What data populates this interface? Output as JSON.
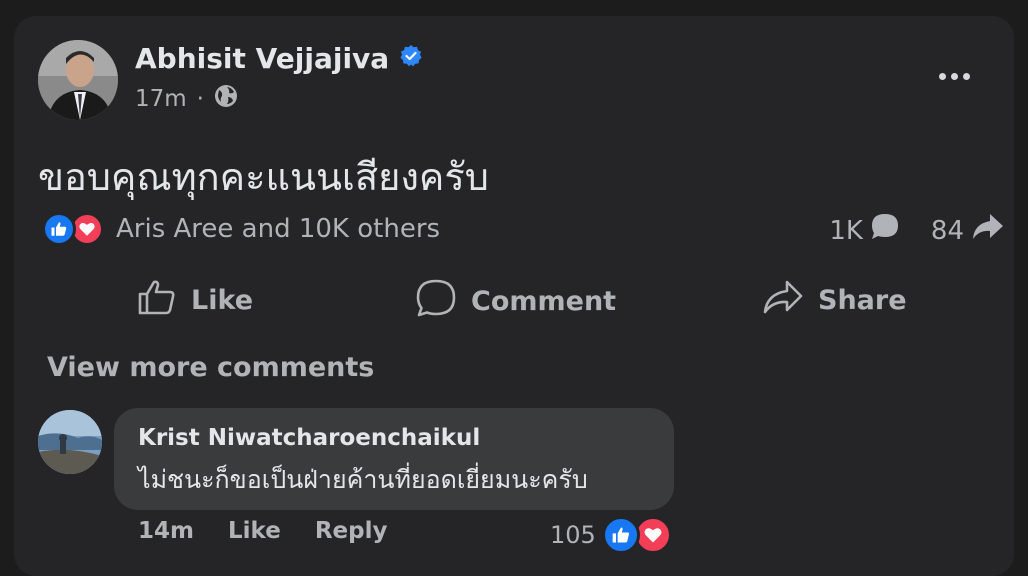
{
  "post": {
    "author": "Abhisit Vejjajiva",
    "time": "17m",
    "separator": "·",
    "text": "ขอบคุณทุกคะแนนเสียงครับ",
    "reactions_names": "Aris Aree and 10K others",
    "comments_count": "1K",
    "shares_count": "84"
  },
  "actions": {
    "like": "Like",
    "comment": "Comment",
    "share": "Share"
  },
  "view_more": "View more comments",
  "comment": {
    "author": "Krist Niwatcharoenchaikul",
    "text": "ไม่ชนะก็ขอเป็นฝ่ายค้านที่ยอดเยี่ยมนะครับ",
    "time": "14m",
    "like_label": "Like",
    "reply_label": "Reply",
    "reaction_count": "105"
  },
  "colors": {
    "background": "#1c1c1d",
    "card": "#252527",
    "bubble": "#3a3b3d",
    "like_blue": "#1877f2",
    "love_red": "#f33e58",
    "verified": "#2d88ff"
  },
  "icons": [
    "verified-badge-icon",
    "globe-icon",
    "more-options-icon",
    "like-reaction-icon",
    "love-reaction-icon",
    "comment-count-icon",
    "share-count-icon",
    "like-icon",
    "comment-icon",
    "share-icon"
  ]
}
